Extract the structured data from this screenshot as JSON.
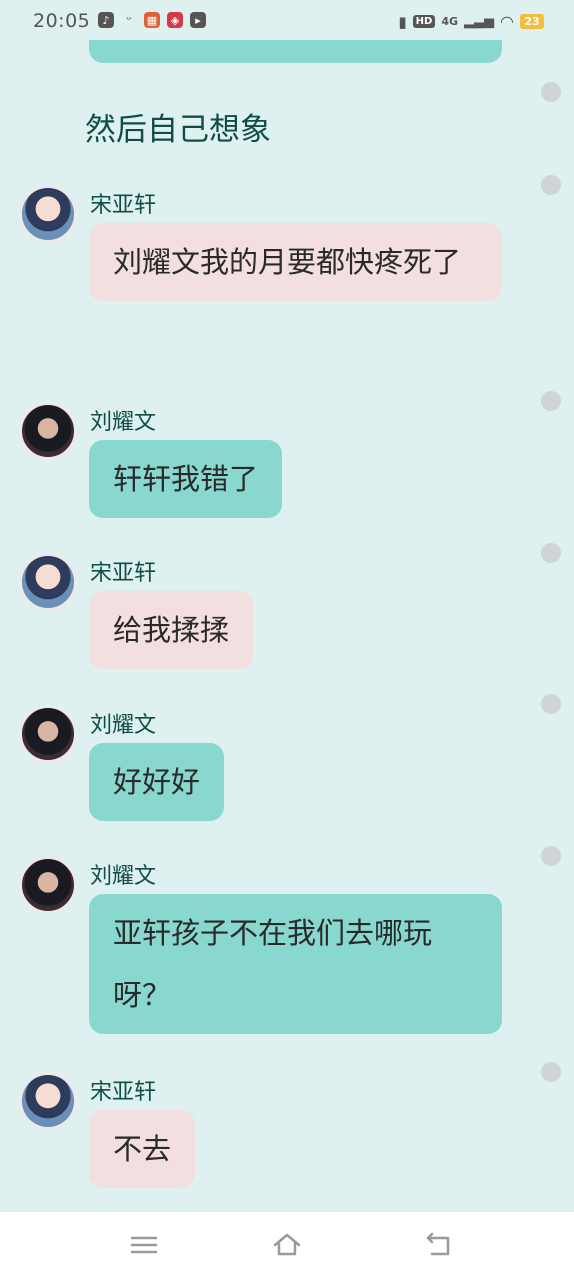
{
  "status_bar": {
    "time": "20:05",
    "network": "4G",
    "hd": "HD",
    "battery": "23"
  },
  "chat": {
    "narration": "然后自己想象",
    "messages": [
      {
        "sender": "宋亚轩",
        "text": "刘耀文我的月要都快疼死了",
        "style": "pink"
      },
      {
        "sender": "刘耀文",
        "text": "轩轩我错了",
        "style": "teal"
      },
      {
        "sender": "宋亚轩",
        "text": "给我揉揉",
        "style": "pink"
      },
      {
        "sender": "刘耀文",
        "text": "好好好",
        "style": "teal"
      },
      {
        "sender": "刘耀文",
        "text": "亚轩孩子不在我们去哪玩呀？",
        "style": "teal"
      },
      {
        "sender": "宋亚轩",
        "text": "不去",
        "style": "pink"
      }
    ]
  },
  "colors": {
    "background": "#dff0f1",
    "teal_bubble": "#88d8cf",
    "pink_bubble": "#f3dfe0",
    "name_text": "#0f4f43"
  },
  "nav": {
    "menu_icon": "menu-icon",
    "home_icon": "home-icon",
    "back_icon": "back-icon"
  }
}
